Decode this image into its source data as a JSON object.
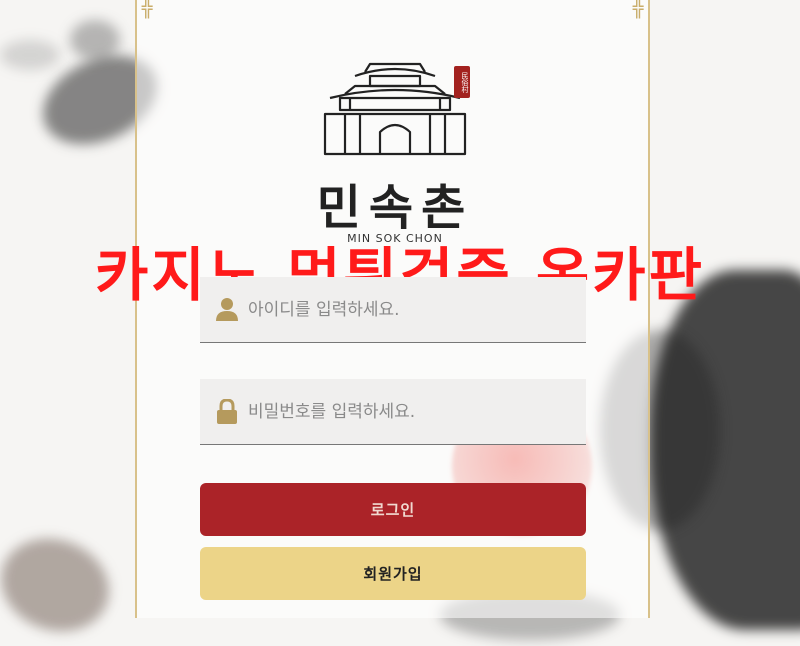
{
  "brand": {
    "seal_text": "民俗村",
    "name_kr": "민속촌",
    "name_en": "MIN SOK CHON"
  },
  "headline": "카지노 먹튀검증 온카판",
  "login_form": {
    "id_field": {
      "placeholder": "아이디를 입력하세요.",
      "value": "",
      "icon": "user-icon"
    },
    "password_field": {
      "placeholder": "비밀번호를 입력하세요.",
      "value": "",
      "icon": "lock-icon"
    },
    "login_button": "로그인",
    "join_button": "회원가입"
  },
  "colors": {
    "headline": "#ff1a1a",
    "login_button": "#ab2328",
    "join_button": "#ecd488",
    "panel_border": "#d8c18a",
    "icon": "#b59a5d"
  }
}
